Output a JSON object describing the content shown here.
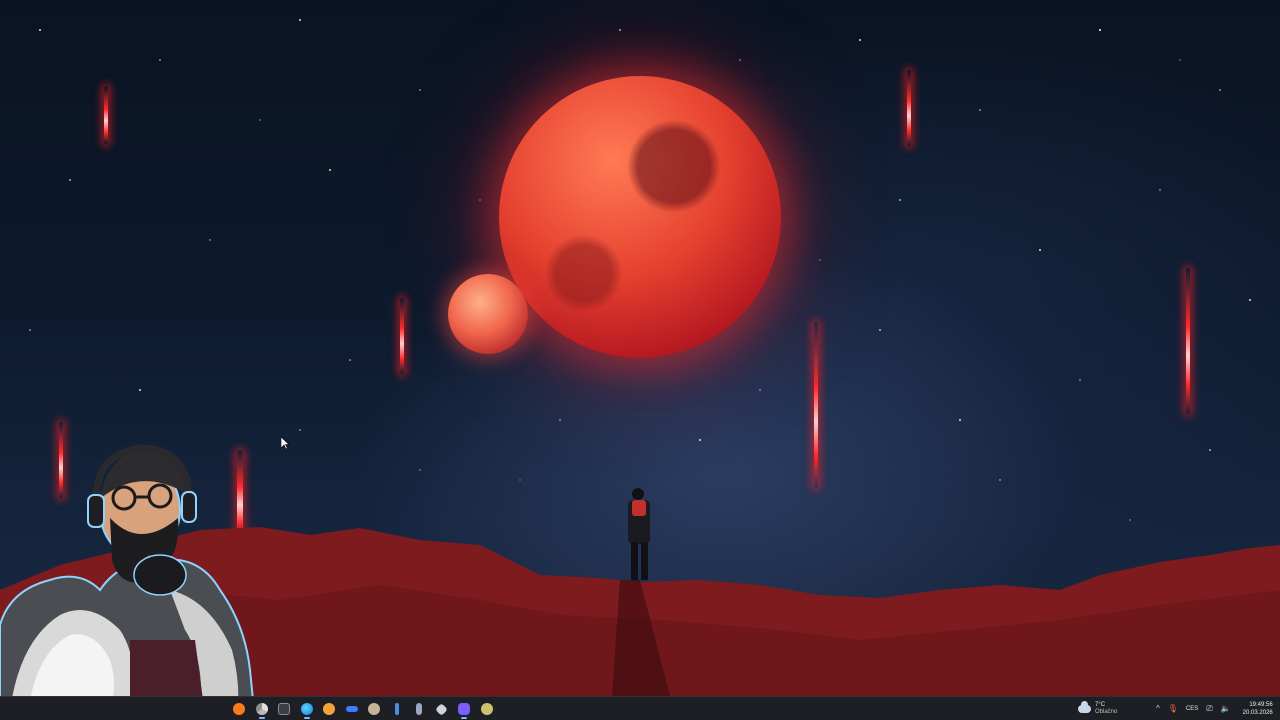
{
  "desktop": {
    "wallpaper": "red-planet-night-sky",
    "colors": {
      "planet": "#e5412f",
      "meteor": "#ff2a2a",
      "ground": "#8a1f22",
      "sky": "#0d1a2e"
    }
  },
  "taskbar": {
    "apps": [
      {
        "name": "firefox-icon",
        "color": "#ff7a1a",
        "active": true
      },
      {
        "name": "chrome-icon",
        "color": "#e0e0e0",
        "active": true
      },
      {
        "name": "terminal-icon",
        "color": "#8a8f99",
        "active": false
      },
      {
        "name": "edge-icon",
        "color": "#2fa4e6",
        "active": true
      },
      {
        "name": "app-icon",
        "color": "#f4a23c",
        "active": false
      },
      {
        "name": "media-icon",
        "color": "#3d7bff",
        "active": false
      },
      {
        "name": "settings-app-icon",
        "color": "#c7b39a",
        "active": false
      },
      {
        "name": "info-icon",
        "color": "#4a90e2",
        "active": false
      },
      {
        "name": "tool-icon",
        "color": "#9aa6c2",
        "active": false
      },
      {
        "name": "cube-icon",
        "color": "#cfd4da",
        "active": false
      },
      {
        "name": "chat-icon",
        "color": "#7b5cff",
        "active": true
      },
      {
        "name": "game-icon",
        "color": "#c9c46b",
        "active": false
      }
    ],
    "weather": {
      "temp": "7°C",
      "condition": "Oblačno",
      "icon": "cloud-icon"
    },
    "tray": {
      "chevron": "^",
      "mic": "🎙",
      "lang": "CES",
      "network": "⎚",
      "volume": "🔈"
    },
    "clock": {
      "time": "19:49:56",
      "date": "20.03.2026"
    }
  }
}
